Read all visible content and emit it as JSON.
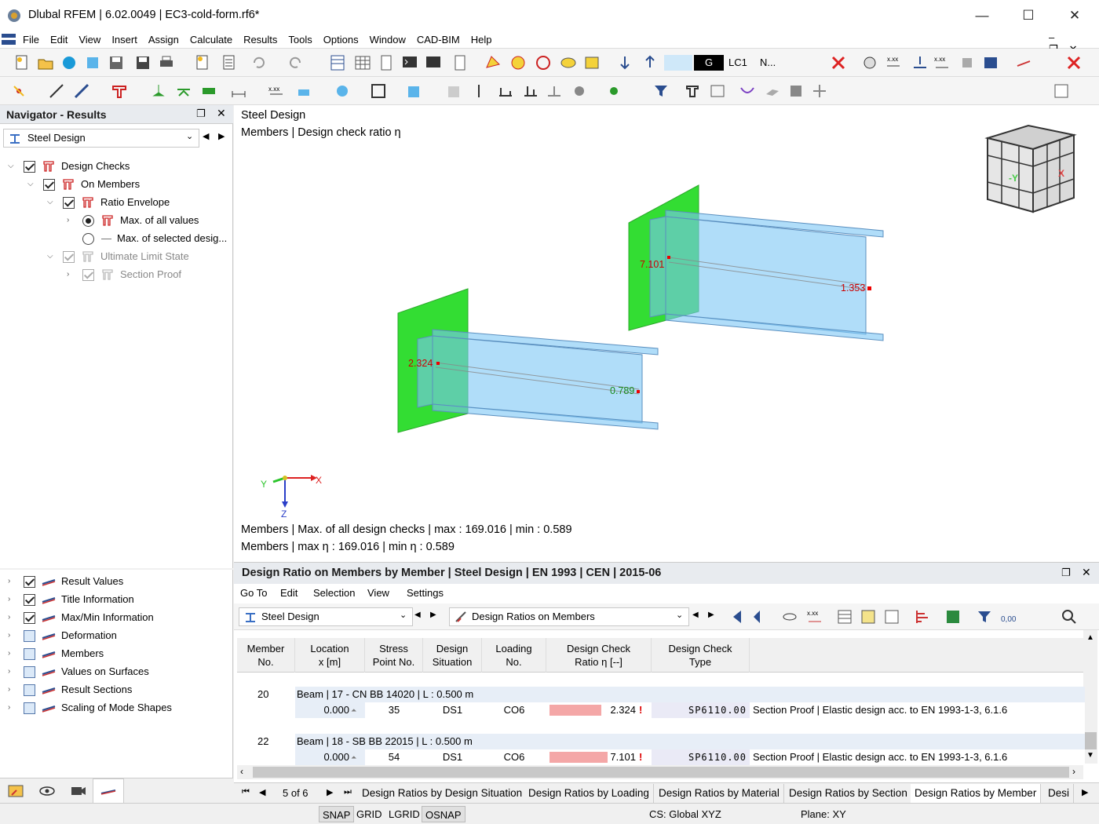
{
  "window": {
    "title": "Dlubal RFEM | 6.02.0049 | EC3-cold-form.rf6*",
    "minimize": "—",
    "maximize": "☐",
    "close": "✕"
  },
  "menu": [
    "File",
    "Edit",
    "View",
    "Insert",
    "Assign",
    "Calculate",
    "Results",
    "Tools",
    "Options",
    "Window",
    "CAD-BIM",
    "Help"
  ],
  "toolbar": {
    "load_case_code": "G",
    "load_case": "LC1",
    "view_option": "N..."
  },
  "navigator": {
    "title": "Navigator - Results",
    "module": "Steel Design",
    "tree": [
      {
        "label": "Design Checks"
      },
      {
        "label": "On Members"
      },
      {
        "label": "Ratio Envelope"
      },
      {
        "label": "Max. of all values"
      },
      {
        "label": "Max. of selected desig..."
      },
      {
        "label": "Ultimate Limit State"
      },
      {
        "label": "Section Proof"
      }
    ],
    "display": [
      {
        "label": "Result Values"
      },
      {
        "label": "Title Information"
      },
      {
        "label": "Max/Min Information"
      },
      {
        "label": "Deformation"
      },
      {
        "label": "Members"
      },
      {
        "label": "Values on Surfaces"
      },
      {
        "label": "Result Sections"
      },
      {
        "label": "Scaling of Mode Shapes"
      }
    ]
  },
  "viewport": {
    "title1": "Steel Design",
    "title2": "Members | Design check ratio η",
    "labels": {
      "v1": "7.101",
      "v2": "1.353",
      "v3": "2.324",
      "v4": "0.789"
    },
    "axes": {
      "x": "X",
      "y": "Y",
      "z": "Z"
    },
    "cube": {
      "y": "-Y",
      "x": "X"
    },
    "info1": "Members | Max. of all design checks | max  : 169.016 | min  : 0.589",
    "info2": "Members | max η : 169.016 | min η : 0.589"
  },
  "results": {
    "title": "Design Ratio on Members by Member | Steel Design | EN 1993 | CEN | 2015-06",
    "menu": [
      "Go To",
      "Edit",
      "Selection",
      "View",
      "Settings"
    ],
    "module": "Steel Design",
    "table_type": "Design Ratios on Members",
    "columns": [
      {
        "l1": "Member",
        "l2": "No."
      },
      {
        "l1": "Location",
        "l2": "x [m]"
      },
      {
        "l1": "Stress",
        "l2": "Point No."
      },
      {
        "l1": "Design",
        "l2": "Situation"
      },
      {
        "l1": "Loading",
        "l2": "No."
      },
      {
        "l1": "Design Check",
        "l2": "Ratio η [--]"
      },
      {
        "l1": "Design Check",
        "l2": "Type"
      }
    ],
    "groups": [
      {
        "member": "20",
        "desc": "Beam | 17 - CN BB 14020 | L : 0.500 m",
        "row": {
          "x": "0.000",
          "sp": "35",
          "ds": "DS1",
          "load": "CO6",
          "ratio": "2.324",
          "ratio_fill": 0.55,
          "type_code": "SP6110.00",
          "type_desc": "Section Proof | Elastic design acc. to EN 1993-1-3, 6.1.6"
        }
      },
      {
        "member": "22",
        "desc": "Beam | 18 - SB BB 22015 | L : 0.500 m",
        "row": {
          "x": "0.000",
          "sp": "54",
          "ds": "DS1",
          "load": "CO6",
          "ratio": "7.101",
          "ratio_fill": 0.62,
          "type_code": "SP6110.00",
          "type_desc": "Section Proof | Elastic design acc. to EN 1993-1-3, 6.1.6"
        }
      }
    ],
    "pager": "5 of 6",
    "tabs": [
      "Design Ratios by Design Situation",
      "Design Ratios by Loading",
      "Design Ratios by Material",
      "Design Ratios by Section",
      "Design Ratios by Member",
      "Desi"
    ],
    "active_tab": "Design Ratios by Member"
  },
  "statusbar": {
    "buttons": [
      "SNAP",
      "GRID",
      "LGRID",
      "OSNAP"
    ],
    "cs": "CS: Global XYZ",
    "plane": "Plane: XY"
  }
}
